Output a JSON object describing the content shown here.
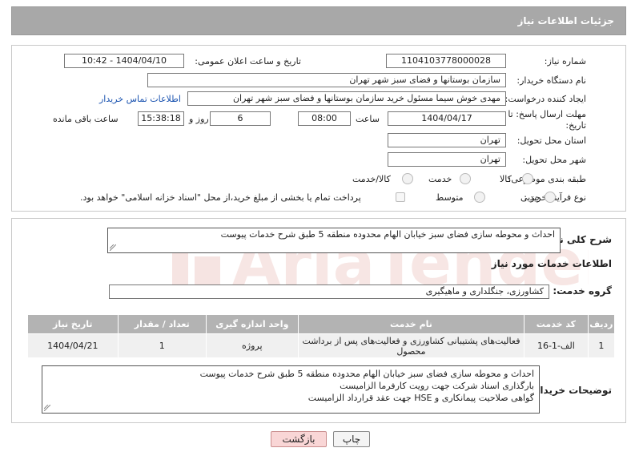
{
  "header": {
    "title": "جزئیات اطلاعات نیاز"
  },
  "form": {
    "need_number": {
      "label": "شماره نیاز:",
      "value": "1104103778000028"
    },
    "announce_datetime": {
      "label": "تاریخ و ساعت اعلان عمومی:",
      "value": "1404/04/10 - 10:42"
    },
    "buyer_org": {
      "label": "نام دستگاه خریدار:",
      "value": "سازمان بوستانها و فضای سبز شهر تهران"
    },
    "creator": {
      "label": "ایجاد کننده درخواست:",
      "value": "مهدی خوش سیما مسئول خرید سازمان بوستانها و فضای سبز شهر تهران",
      "contact_link": "اطلاعات تماس خریدار"
    },
    "deadline": {
      "label_line1": "مهلت ارسال پاسخ: تا",
      "label_line2": "تاریخ:",
      "date": "1404/04/17",
      "time_label": "ساعت",
      "time": "08:00",
      "days": "6",
      "days_label": "روز و",
      "remaining": "15:38:18",
      "remaining_label": "ساعت باقی مانده"
    },
    "province": {
      "label": "استان محل تحویل:",
      "value": "تهران"
    },
    "city": {
      "label": "شهر محل تحویل:",
      "value": "تهران"
    },
    "category": {
      "label": "طبقه بندی موضوعی:",
      "options": [
        "کالا",
        "خدمت",
        "کالا/خدمت"
      ]
    },
    "purchase_type": {
      "label": "نوع فرآیند خرید :",
      "options": [
        "جزیی",
        "متوسط"
      ],
      "payment_note": "پرداخت تمام یا بخشی از مبلغ خرید،از محل \"اسناد خزانه اسلامی\" خواهد بود."
    }
  },
  "description": {
    "label": "شرح کلی نیاز:",
    "value": "احداث و محوطه سازی فضای سبز خیابان الهام محدوده منطقه 5 طبق شرح خدمات پیوست"
  },
  "services": {
    "section_title": "اطلاعات خدمات مورد نیاز",
    "group_label": "گروه خدمت:",
    "group_value": "کشاورزی، جنگلداری و ماهیگیری",
    "columns": [
      "ردیف",
      "کد خدمت",
      "نام خدمت",
      "واحد اندازه گیری",
      "تعداد / مقدار",
      "تاریخ نیاز"
    ],
    "rows": [
      {
        "row": "1",
        "code": "الف-1-16",
        "name": "فعالیت‌های پشتیبانی کشاورزی و فعالیت‌های پس از برداشت محصول",
        "unit": "پروژه",
        "qty": "1",
        "date": "1404/04/21"
      }
    ]
  },
  "buyer_notes": {
    "label": "توضیحات خریدار:",
    "lines": [
      "احداث و محوطه سازی فضای سبز خیابان الهام محدوده منطقه 5 طبق شرح خدمات پیوست",
      "بارگذاری اسناد شرکت جهت رویت کارفرما الزامیست",
      "گواهی صلاحیت پیمانکاری و HSE جهت عقد قرارداد الزامیست"
    ]
  },
  "buttons": {
    "print": "چاپ",
    "back": "بازگشت"
  },
  "watermark": {
    "text": "AriaTender.neT"
  },
  "colors": {
    "header_bg": "#a8a8a8",
    "table_header_bg": "#b3b3b3",
    "link": "#1a53b0",
    "back_btn_bg": "#f9d6d6"
  }
}
